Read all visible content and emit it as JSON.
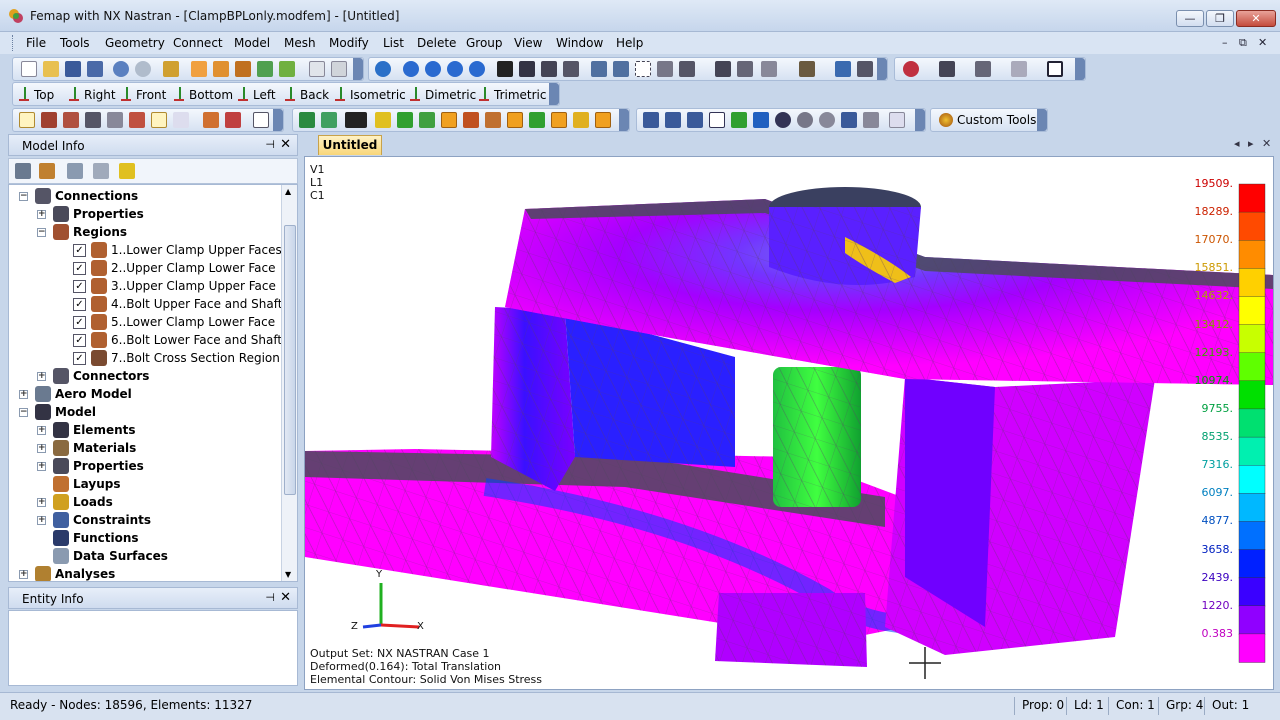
{
  "window": {
    "title": "Femap with NX Nastran - [ClampBPLonly.modfem] - [Untitled]",
    "min_glyph": "—",
    "max_glyph": "❐",
    "close_glyph": "✕"
  },
  "menu": [
    "File",
    "Tools",
    "Geometry",
    "Connect",
    "Model",
    "Mesh",
    "Modify",
    "List",
    "Delete",
    "Group",
    "View",
    "Window",
    "Help"
  ],
  "mdi_controls": [
    "–",
    "⧉",
    "✕"
  ],
  "view_toolbar": [
    "Top",
    "Right",
    "Front",
    "Bottom",
    "Left",
    "Back",
    "Isometric",
    "Dimetric",
    "Trimetric"
  ],
  "custom_tools_label": "Custom Tools",
  "colors": {
    "accent": "#6b86b3",
    "chrome": "#c7d6ea",
    "tab": "#f8d67a"
  },
  "model_info": {
    "title": "Model Info",
    "pin": "⊣",
    "close": "✕",
    "tree": [
      {
        "label": "Connections",
        "level": 1,
        "expander": "⊟",
        "bold": true,
        "icon": "connections-icon"
      },
      {
        "label": "Properties",
        "level": 2,
        "expander": "⊞",
        "bold": true,
        "icon": "properties-icon"
      },
      {
        "label": "Regions",
        "level": 2,
        "expander": "⊟",
        "bold": true,
        "icon": "regions-icon"
      },
      {
        "label": "1..Lower Clamp Upper Faces",
        "level": 3,
        "checked": true,
        "icon": "region-icon"
      },
      {
        "label": "2..Upper Clamp Lower Face",
        "level": 3,
        "checked": true,
        "icon": "region-icon"
      },
      {
        "label": "3..Upper Clamp Upper Face",
        "level": 3,
        "checked": true,
        "icon": "region-icon"
      },
      {
        "label": "4..Bolt Upper Face and Shaft",
        "level": 3,
        "checked": true,
        "icon": "region-icon"
      },
      {
        "label": "5..Lower Clamp Lower Face",
        "level": 3,
        "checked": true,
        "icon": "region-icon"
      },
      {
        "label": "6..Bolt Lower Face and Shaft",
        "level": 3,
        "checked": true,
        "icon": "region-icon"
      },
      {
        "label": "7..Bolt Cross Section Region",
        "level": 3,
        "checked": true,
        "icon": "bolt-region-icon"
      },
      {
        "label": "Connectors",
        "level": 2,
        "expander": "⊞",
        "bold": true,
        "icon": "connectors-icon"
      },
      {
        "label": "Aero Model",
        "level": 1,
        "expander": "⊞",
        "bold": true,
        "icon": "aero-icon"
      },
      {
        "label": "Model",
        "level": 1,
        "expander": "⊟",
        "bold": true,
        "icon": "model-icon"
      },
      {
        "label": "Elements",
        "level": 2,
        "expander": "⊞",
        "bold": true,
        "icon": "elements-icon"
      },
      {
        "label": "Materials",
        "level": 2,
        "expander": "⊞",
        "bold": true,
        "icon": "materials-icon"
      },
      {
        "label": "Properties",
        "level": 2,
        "expander": "⊞",
        "bold": true,
        "icon": "properties-icon"
      },
      {
        "label": "Layups",
        "level": 2,
        "bold": true,
        "icon": "layups-icon"
      },
      {
        "label": "Loads",
        "level": 2,
        "expander": "⊞",
        "bold": true,
        "icon": "loads-icon"
      },
      {
        "label": "Constraints",
        "level": 2,
        "expander": "⊞",
        "bold": true,
        "icon": "constraints-icon"
      },
      {
        "label": "Functions",
        "level": 2,
        "bold": true,
        "icon": "functions-icon"
      },
      {
        "label": "Data Surfaces",
        "level": 2,
        "bold": true,
        "icon": "data-surfaces-icon"
      },
      {
        "label": "Analyses",
        "level": 1,
        "expander": "⊞",
        "bold": true,
        "icon": "analyses-icon"
      }
    ]
  },
  "entity_info": {
    "title": "Entity Info",
    "pin": "⊣",
    "close": "✕"
  },
  "doc_tab": "Untitled",
  "viewport": {
    "view_labels": [
      "V1",
      "L1",
      "C1"
    ],
    "info_lines": [
      "Output Set: NX NASTRAN Case 1",
      "Deformed(0.164): Total Translation",
      "Elemental Contour: Solid Von Mises Stress"
    ],
    "axis_labels": {
      "y": "Y",
      "z": "Z",
      "x": "X"
    }
  },
  "legend": {
    "values": [
      "19509.",
      "18289.",
      "17070.",
      "15851.",
      "14632.",
      "13412.",
      "12193.",
      "10974.",
      "9755.",
      "8535.",
      "7316.",
      "6097.",
      "4877.",
      "3658.",
      "2439.",
      "1220.",
      "0.383"
    ],
    "colors": [
      "#ff0000",
      "#ff4a00",
      "#ff8c00",
      "#ffd000",
      "#ffff00",
      "#c8ff00",
      "#5fff00",
      "#00e000",
      "#00e070",
      "#00f0b0",
      "#00ffff",
      "#00b8ff",
      "#0070ff",
      "#0020ff",
      "#3a00ff",
      "#9000ff",
      "#ff00ff"
    ],
    "value_colors": [
      "#cc0000",
      "#cc2200",
      "#cc5500",
      "#cc9900",
      "#b0a000",
      "#8a9a00",
      "#40a000",
      "#00a000",
      "#00a040",
      "#00a070",
      "#00a0a0",
      "#0080c0",
      "#0050c0",
      "#0020c0",
      "#3a00c0",
      "#7000c0",
      "#c000c0"
    ]
  },
  "status": {
    "ready": "Ready - Nodes: 18596,  Elements: 11327",
    "prop": "Prop: 0",
    "ld": "Ld: 1",
    "con": "Con: 1",
    "grp": "Grp: 4",
    "out": "Out: 1"
  }
}
